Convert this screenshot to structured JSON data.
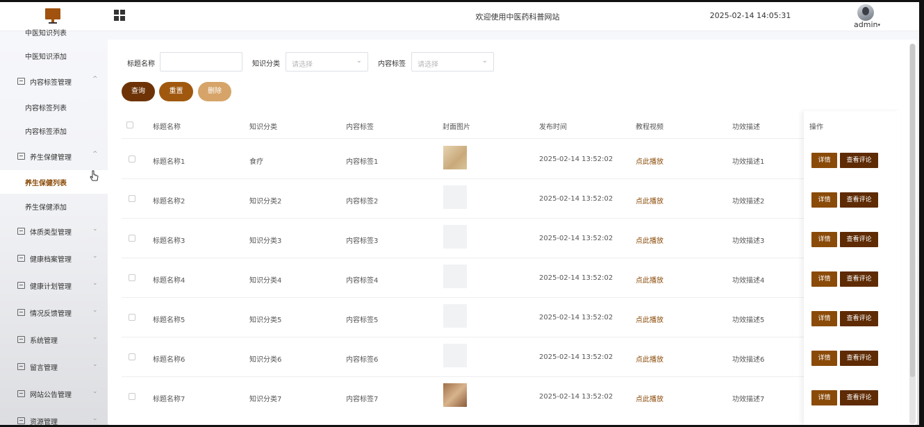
{
  "header": {
    "site_title": "欢迎使用中医药科普网站",
    "clock": "2025-02-14 14:05:31",
    "username": "admin"
  },
  "sidebar": {
    "items": [
      {
        "type": "sub",
        "label": "中医知识列表",
        "icon": ""
      },
      {
        "type": "sub",
        "label": "中医知识添加",
        "icon": ""
      },
      {
        "type": "group",
        "label": "内容标签管理",
        "icon": "menu-box-icon",
        "expanded": true
      },
      {
        "type": "sub",
        "label": "内容标签列表",
        "icon": ""
      },
      {
        "type": "sub",
        "label": "内容标签添加",
        "icon": ""
      },
      {
        "type": "group",
        "label": "养生保健管理",
        "icon": "menu-box-icon",
        "expanded": true
      },
      {
        "type": "sub",
        "label": "养生保健列表",
        "icon": "",
        "active": true
      },
      {
        "type": "sub",
        "label": "养生保健添加",
        "icon": ""
      },
      {
        "type": "group",
        "label": "体质类型管理",
        "icon": "menu-box-icon"
      },
      {
        "type": "group",
        "label": "健康档案管理",
        "icon": "menu-box-icon"
      },
      {
        "type": "group",
        "label": "健康计划管理",
        "icon": "menu-box-icon"
      },
      {
        "type": "group",
        "label": "情况反馈管理",
        "icon": "menu-box-icon"
      },
      {
        "type": "group",
        "label": "系统管理",
        "icon": "folder-icon"
      },
      {
        "type": "group",
        "label": "留言管理",
        "icon": "folder-icon"
      },
      {
        "type": "group",
        "label": "网站公告管理",
        "icon": "sun-icon"
      },
      {
        "type": "group",
        "label": "资源管理",
        "icon": "box-icon"
      }
    ]
  },
  "filters": {
    "title_label": "标题名称",
    "title_value": "",
    "category_label": "知识分类",
    "category_placeholder": "请选择",
    "tag_label": "内容标签",
    "tag_placeholder": "请选择"
  },
  "buttons": {
    "query": "查询",
    "reset": "重置",
    "delete": "删除"
  },
  "table": {
    "columns": [
      "标题名称",
      "知识分类",
      "内容标签",
      "封面图片",
      "发布时间",
      "教程视频",
      "功效描述",
      "操作"
    ],
    "detail_label": "详情",
    "comment_label": "查看评论",
    "rows": [
      {
        "title": "标题名称1",
        "category": "食疗",
        "tag": "内容标签1",
        "cover": "paper-image",
        "time": "2025-02-14 13:52:02",
        "video": "点此播放",
        "desc": "功效描述1"
      },
      {
        "title": "标题名称2",
        "category": "知识分类2",
        "tag": "内容标签2",
        "cover": "empty",
        "time": "2025-02-14 13:52:02",
        "video": "点此播放",
        "desc": "功效描述2"
      },
      {
        "title": "标题名称3",
        "category": "知识分类3",
        "tag": "内容标签3",
        "cover": "empty",
        "time": "2025-02-14 13:52:02",
        "video": "点此播放",
        "desc": "功效描述3"
      },
      {
        "title": "标题名称4",
        "category": "知识分类4",
        "tag": "内容标签4",
        "cover": "empty",
        "time": "2025-02-14 13:52:02",
        "video": "点此播放",
        "desc": "功效描述4"
      },
      {
        "title": "标题名称5",
        "category": "知识分类5",
        "tag": "内容标签5",
        "cover": "empty",
        "time": "2025-02-14 13:52:02",
        "video": "点此播放",
        "desc": "功效描述5"
      },
      {
        "title": "标题名称6",
        "category": "知识分类6",
        "tag": "内容标签6",
        "cover": "empty",
        "time": "2025-02-14 13:52:02",
        "video": "点此播放",
        "desc": "功效描述6"
      },
      {
        "title": "标题名称7",
        "category": "知识分类7",
        "tag": "内容标签7",
        "cover": "paper-image",
        "time": "2025-02-14 13:52:02",
        "video": "点此播放",
        "desc": "功效描述7"
      }
    ]
  },
  "colors": {
    "brand_dark": "#6d3307",
    "brand": "#a0580f",
    "brand_light": "#d6a469",
    "action_detail": "#8a4a08",
    "action_comment": "#5e2b05"
  }
}
